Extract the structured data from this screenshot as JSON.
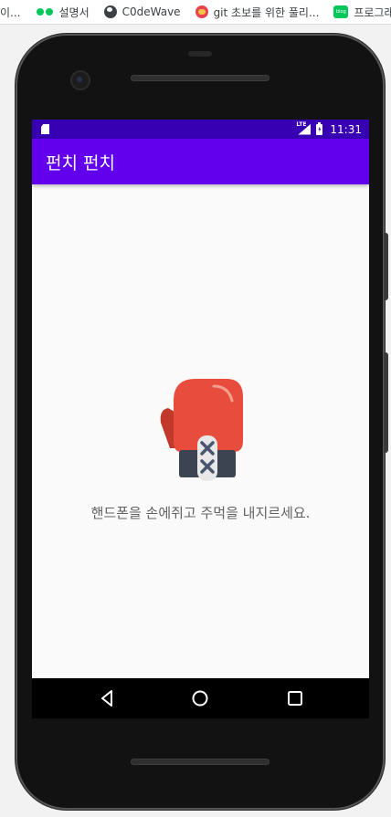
{
  "browser": {
    "bookmarks": [
      {
        "label": "이...",
        "icon": "none"
      },
      {
        "label": "설명서",
        "icon": "naver-dots-icon"
      },
      {
        "label": "C0deWave",
        "icon": "globe-icon"
      },
      {
        "label": "git 초보를 위한 풀리...",
        "icon": "favicon-icon"
      },
      {
        "label": "프로그래",
        "icon": "blog-icon"
      }
    ],
    "blog_icon_text": "blog"
  },
  "status_bar": {
    "time": "11:31",
    "network": "LTE",
    "background_color": "#3700b3"
  },
  "app_bar": {
    "title": "펀치 펀치",
    "background_color": "#6200ee"
  },
  "main": {
    "image": "boxing-glove-icon",
    "message": "핸드폰을 손에쥐고 주먹을 내지르세요."
  },
  "nav_bar": {
    "buttons": [
      "back-icon",
      "home-icon",
      "recents-icon"
    ]
  },
  "colors": {
    "glove_red": "#e74c3c",
    "glove_dark_red": "#c0392b",
    "cuff": "#3d4451",
    "lace_panel": "#e8e8e8",
    "lace": "#4a5570"
  }
}
